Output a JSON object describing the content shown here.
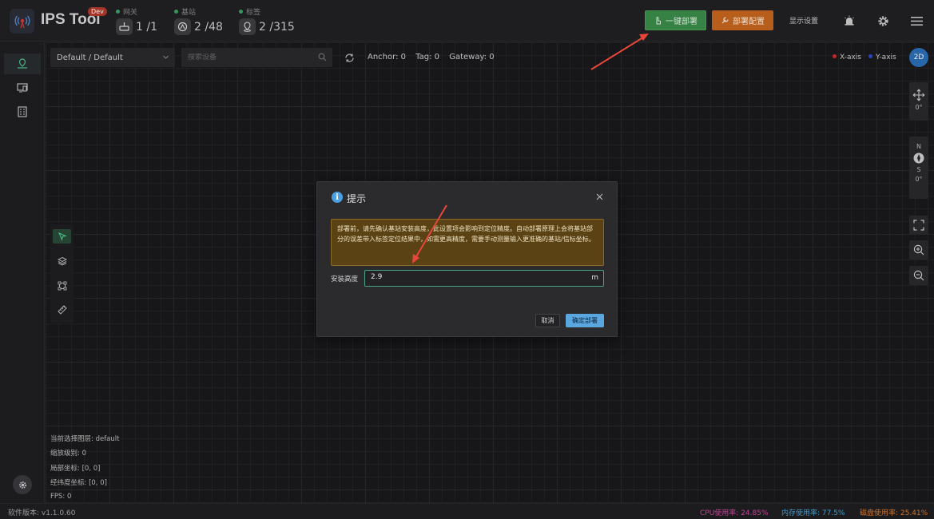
{
  "app": {
    "title": "IPS Tool",
    "badge": "Dev"
  },
  "stats": [
    {
      "label": "网关",
      "value": "1 /1",
      "icon": "gateway-icon"
    },
    {
      "label": "基站",
      "value": "2 /48",
      "icon": "anchor-station-icon"
    },
    {
      "label": "标签",
      "value": "2 /315",
      "icon": "tag-location-icon"
    }
  ],
  "header": {
    "deploy_label": "一键部署",
    "config_label": "部署配置",
    "display_label": "显示设置"
  },
  "toolbar": {
    "layer_select": "Default / Default",
    "search_placeholder": "搜索设备",
    "anchor_count": "Anchor: 0",
    "tag_count": "Tag: 0",
    "gateway_count": "Gateway: 0"
  },
  "legend": {
    "x_axis": "X-axis",
    "y_axis": "Y-axis",
    "x_color": "#d22b2b",
    "y_color": "#2b4bd2"
  },
  "view": {
    "mode_label": "2D",
    "move_rotation": "0°",
    "compass_n": "N",
    "compass_s": "S",
    "compass_rotation": "0°"
  },
  "info": {
    "layer": "当前选择图层:  default",
    "zoom": "缩放级别:  0",
    "local_coord": "局部坐标:  [0, 0]",
    "geo_coord": "经纬度坐标:  [0, 0]",
    "fps": "FPS:  0"
  },
  "statusbar": {
    "version": "软件版本: v1.1.0.60",
    "cpu": "CPU使用率: 24.85%",
    "memory": "内存使用率: 77.5%",
    "disk": "磁盘使用率: 25.41%",
    "cpu_color": "#d04aa0",
    "memory_color": "#4aa7d8",
    "disk_color": "#e07a2a"
  },
  "dialog": {
    "title": "提示",
    "warning": "部署前，请先确认基站安装高度，此设置项会影响到定位精度。自动部署原理上会将基站部分的误差带入标签定位结果中，如需更高精度，需要手动测量输入更准确的基站/信标坐标。",
    "height_label": "安装高度",
    "height_value": "2.9",
    "unit": "m",
    "cancel_label": "取消",
    "confirm_label": "确定部署"
  },
  "colors": {
    "deploy_button": "#3b8c4a",
    "config_button": "#c7671f",
    "annotation_arrow": "#e8463a",
    "input_focus": "#4aa585",
    "confirm_button": "#5aa7e0"
  }
}
